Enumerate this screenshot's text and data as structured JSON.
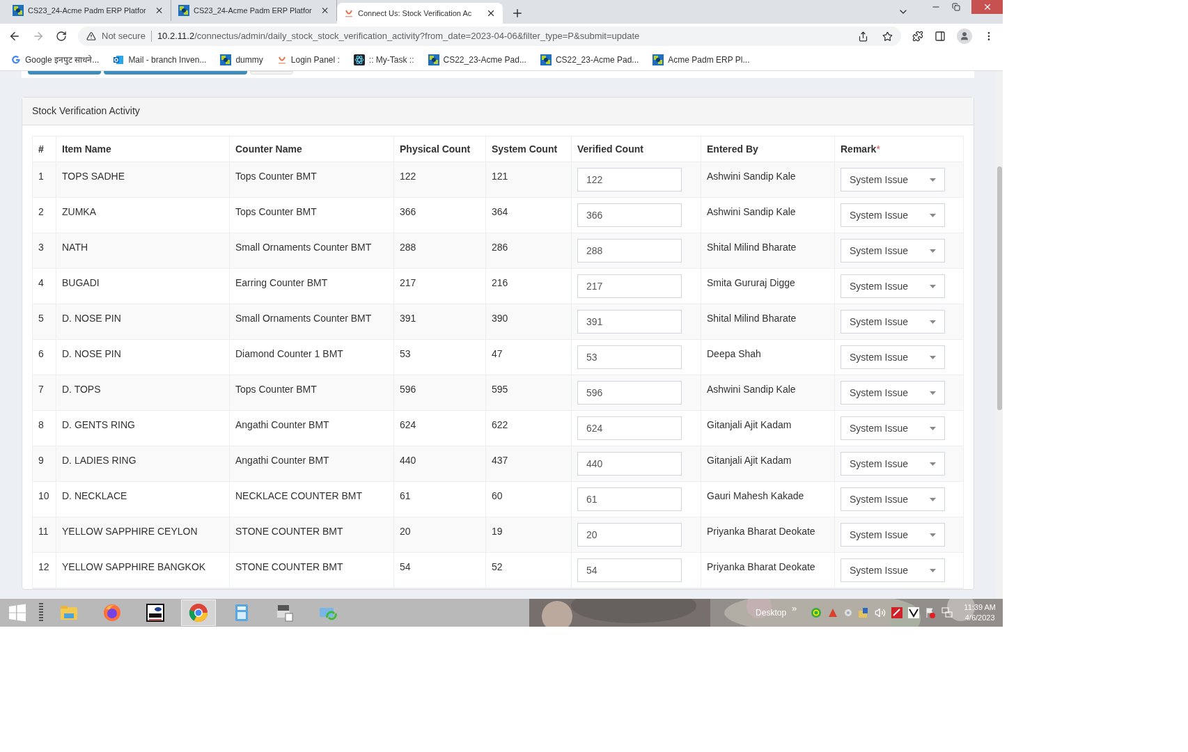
{
  "browser": {
    "tabs": [
      {
        "title": "CS23_24-Acme Padm ERP Platfor",
        "kind": "erp",
        "selected": false
      },
      {
        "title": "CS23_24-Acme Padm ERP Platfor",
        "kind": "erp",
        "selected": false
      },
      {
        "title": "Connect Us: Stock Verification Ac",
        "kind": "connectus",
        "selected": true
      }
    ],
    "security": "Not secure",
    "url_host": "10.2.11.2",
    "url_rest": "/connectus/admin/daily_stock_stock_verification_activity?from_date=2023-04-06&filter_type=P&submit=update",
    "bookmarks": [
      {
        "label": "Google इनपुट साधने...",
        "kind": "google"
      },
      {
        "label": "Mail - branch Inven...",
        "kind": "outlook"
      },
      {
        "label": "dummy",
        "kind": "erp"
      },
      {
        "label": "Login Panel :",
        "kind": "connectus"
      },
      {
        "label": ":: My-Task ::",
        "kind": "react"
      },
      {
        "label": "CS22_23-Acme Pad...",
        "kind": "erp"
      },
      {
        "label": "CS22_23-Acme Pad...",
        "kind": "erp"
      },
      {
        "label": "Acme Padm ERP Pl...",
        "kind": "erp"
      }
    ]
  },
  "card": {
    "title": "Stock Verification Activity",
    "columns": [
      {
        "label": "#"
      },
      {
        "label": "Item Name"
      },
      {
        "label": "Counter Name"
      },
      {
        "label": "Physical Count"
      },
      {
        "label": "System Count"
      },
      {
        "label": "Verified Count"
      },
      {
        "label": "Entered By"
      },
      {
        "label": "Remark",
        "required_mark": "*"
      }
    ],
    "rows": [
      {
        "no": "1",
        "item": "TOPS SADHE",
        "counter": "Tops Counter BMT",
        "physical": "122",
        "system": "121",
        "verified": "122",
        "entered_by": "Ashwini Sandip Kale",
        "remark": "System Issue"
      },
      {
        "no": "2",
        "item": "ZUMKA",
        "counter": "Tops Counter BMT",
        "physical": "366",
        "system": "364",
        "verified": "366",
        "entered_by": "Ashwini Sandip Kale",
        "remark": "System Issue"
      },
      {
        "no": "3",
        "item": "NATH",
        "counter": "Small Ornaments Counter BMT",
        "physical": "288",
        "system": "286",
        "verified": "288",
        "entered_by": "Shital Milind Bharate",
        "remark": "System Issue"
      },
      {
        "no": "4",
        "item": "BUGADI",
        "counter": "Earring Counter BMT",
        "physical": "217",
        "system": "216",
        "verified": "217",
        "entered_by": "Smita Gururaj Digge",
        "remark": "System Issue"
      },
      {
        "no": "5",
        "item": "D. NOSE PIN",
        "counter": "Small Ornaments Counter BMT",
        "physical": "391",
        "system": "390",
        "verified": "391",
        "entered_by": "Shital Milind Bharate",
        "remark": "System Issue"
      },
      {
        "no": "6",
        "item": "D. NOSE PIN",
        "counter": "Diamond Counter 1 BMT",
        "physical": "53",
        "system": "47",
        "verified": "53",
        "entered_by": "Deepa Shah",
        "remark": "System Issue"
      },
      {
        "no": "7",
        "item": "D. TOPS",
        "counter": "Tops Counter BMT",
        "physical": "596",
        "system": "595",
        "verified": "596",
        "entered_by": "Ashwini Sandip Kale",
        "remark": "System Issue"
      },
      {
        "no": "8",
        "item": "D. GENTS RING",
        "counter": "Angathi Counter BMT",
        "physical": "624",
        "system": "622",
        "verified": "624",
        "entered_by": "Gitanjali Ajit Kadam",
        "remark": "System Issue"
      },
      {
        "no": "9",
        "item": "D. LADIES RING",
        "counter": "Angathi Counter BMT",
        "physical": "440",
        "system": "437",
        "verified": "440",
        "entered_by": "Gitanjali Ajit Kadam",
        "remark": "System Issue"
      },
      {
        "no": "10",
        "item": "D. NECKLACE",
        "counter": "NECKLACE COUNTER BMT",
        "physical": "61",
        "system": "60",
        "verified": "61",
        "entered_by": "Gauri Mahesh Kakade",
        "remark": "System Issue"
      },
      {
        "no": "11",
        "item": "YELLOW SAPPHIRE CEYLON",
        "counter": "STONE COUNTER BMT",
        "physical": "20",
        "system": "19",
        "verified": "20",
        "entered_by": "Priyanka Bharat Deokate",
        "remark": "System Issue"
      },
      {
        "no": "12",
        "item": "YELLOW SAPPHIRE BANGKOK",
        "counter": "STONE COUNTER BMT",
        "physical": "54",
        "system": "52",
        "verified": "54",
        "entered_by": "Priyanka Bharat Deokate",
        "remark": "System Issue"
      }
    ]
  },
  "taskbar": {
    "apps": [
      {
        "kind": "explorer",
        "selected": false
      },
      {
        "kind": "firefox",
        "selected": false
      },
      {
        "kind": "vnc",
        "selected": false
      },
      {
        "kind": "chrome",
        "selected": true
      },
      {
        "kind": "calculator",
        "selected": false
      },
      {
        "kind": "scanner",
        "selected": false
      },
      {
        "kind": "sync",
        "selected": false
      }
    ],
    "desktop_label": "Desktop",
    "overflow": "»",
    "time": "11:39 AM",
    "date": "4/6/2023"
  }
}
